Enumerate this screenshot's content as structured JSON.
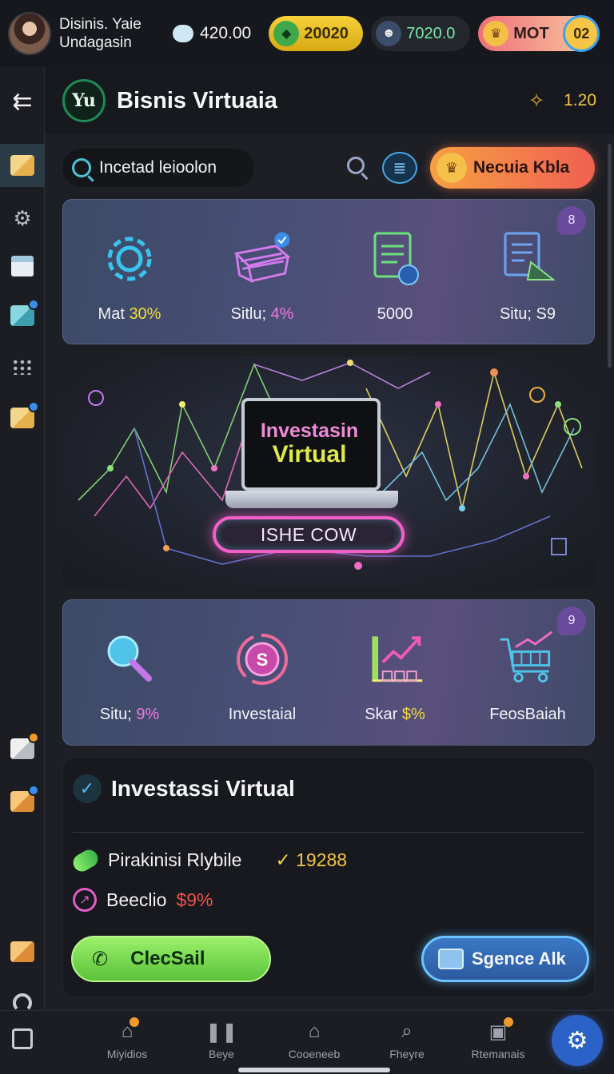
{
  "status_bar": {
    "user_name": "Disinis. Yaie Undagasin",
    "chat_value": "420.00",
    "gold_value": "20020",
    "mask_value": "7020.0",
    "red_label": "MOT",
    "red_badge": "02"
  },
  "header": {
    "logo_text": "Yu",
    "title": "Bisnis Virtuaia",
    "value": "1.20"
  },
  "search": {
    "placeholder": "Incetad leioolon"
  },
  "promo_button": {
    "label": "Necuia Kbla"
  },
  "stats_top": {
    "badge": "8",
    "items": [
      {
        "label": "Mat ",
        "highlight": "30%",
        "icon": "gear-icon"
      },
      {
        "label": "Sitlu; ",
        "highlight": "4%",
        "icon": "crate-icon"
      },
      {
        "label": "5000",
        "highlight": "",
        "icon": "document-icon"
      },
      {
        "label": "Situ; S9",
        "highlight": "",
        "icon": "report-icon"
      }
    ]
  },
  "hero": {
    "title_line1": "Investasin",
    "title_line2": "Virtual",
    "button_label": "ISHE COW"
  },
  "stats_bottom": {
    "badge": "9",
    "items": [
      {
        "label": "Situ; ",
        "highlight": "9%",
        "icon": "magnifier-icon"
      },
      {
        "label": "Investaial",
        "highlight": "",
        "icon": "coin-s-icon"
      },
      {
        "label": "Skar ",
        "highlight": "$%",
        "icon": "growth-chart-icon"
      },
      {
        "label": "FeosBaiah",
        "highlight": "",
        "icon": "cart-chart-icon"
      }
    ]
  },
  "invest_panel": {
    "title": "Investassi Virtual",
    "row1_label": "Pirakinisi Rlybile",
    "row1_value": "19288",
    "row2_label": "Beeclio",
    "row2_value": "$9%",
    "call_button": "ClecSail",
    "secondary_button": "Sgence Alk"
  },
  "bottom_nav": {
    "items": [
      {
        "label": "Miyidios",
        "icon": "home-icon"
      },
      {
        "label": "Beye",
        "icon": "pause-icon"
      },
      {
        "label": "Cooeneeb",
        "icon": "house-icon"
      },
      {
        "label": "Fheyre",
        "icon": "search-icon"
      },
      {
        "label": "Rtemanais",
        "icon": "gift-icon"
      }
    ]
  },
  "colors": {
    "accent_gold": "#f5c542",
    "accent_green": "#7ae37a",
    "accent_pink": "#f45ec8",
    "accent_blue": "#2b62c7"
  }
}
